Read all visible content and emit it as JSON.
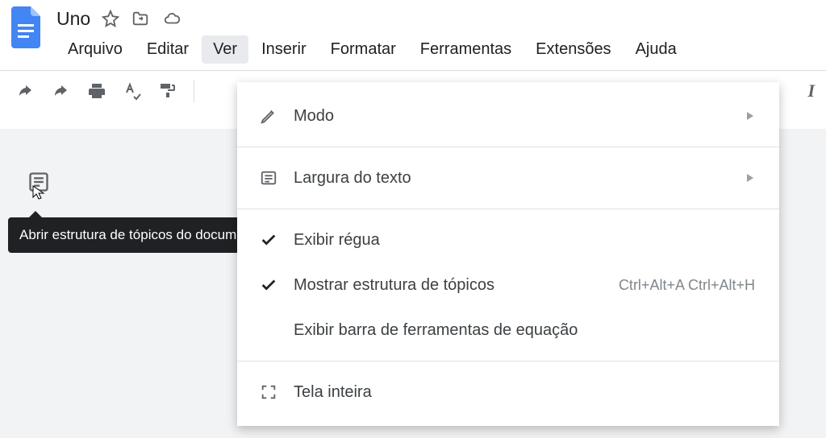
{
  "doc": {
    "title": "Uno"
  },
  "menus": {
    "arquivo": "Arquivo",
    "editar": "Editar",
    "ver": "Ver",
    "inserir": "Inserir",
    "formatar": "Formatar",
    "ferramentas": "Ferramentas",
    "extensoes": "Extensões",
    "ajuda": "Ajuda"
  },
  "tooltip": {
    "outline": "Abrir estrutura de tópicos do documento"
  },
  "dropdown": {
    "modo": "Modo",
    "largura": "Largura do texto",
    "regua": "Exibir régua",
    "estrutura": {
      "label": "Mostrar estrutura de tópicos",
      "shortcut": "Ctrl+Alt+A Ctrl+Alt+H"
    },
    "equacao": "Exibir barra de ferramentas de equação",
    "tela": "Tela inteira"
  },
  "toolbar": {
    "italic_glyph": "I"
  }
}
